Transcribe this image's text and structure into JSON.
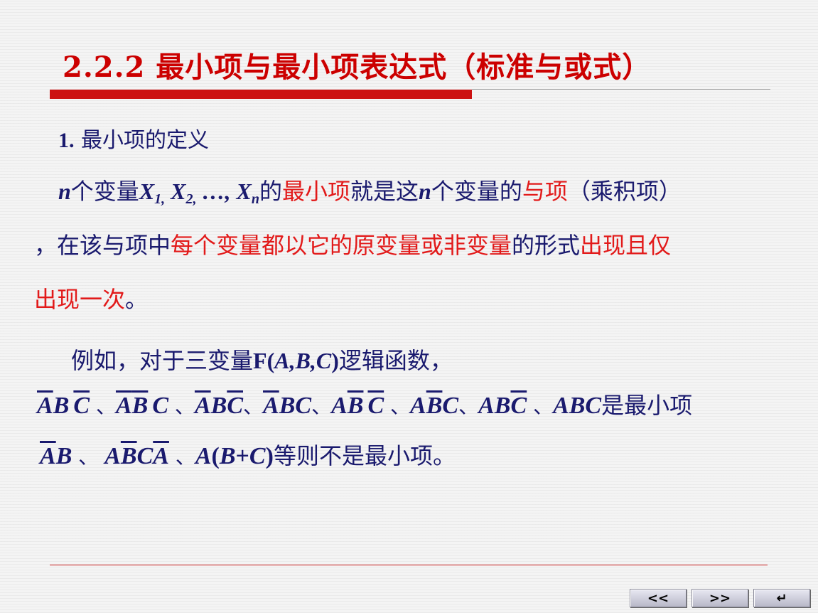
{
  "slide": {
    "title": "2.2.2  最小项与最小项表达式（标准与或式）",
    "heading_num": "1.",
    "heading_text": " 最小项的定义",
    "definition": {
      "n": "n",
      "t1": "个变量",
      "vars": {
        "x1": "X",
        "s1": "1,",
        "x2": " X",
        "s2": "2,",
        "dots": " …, X",
        "sn": "n"
      },
      "t2": "的",
      "t3": "最小项",
      "t4": "就是这",
      "n2": "n",
      "t5": "个变量的",
      "t6": "与项",
      "t7": "（乘积项）",
      "l2_a": "，在该与项中",
      "l2_b": "每个变量都以它的原变量或非变量",
      "l2_c": "的形式",
      "l2_d": "出现且仅",
      "l3_a": "出现一次",
      "l3_b": "。"
    },
    "example": {
      "prefix": "例如，对于三变量",
      "func": "F(",
      "args": "A,B,C",
      "close": ")",
      "suffix": "逻辑函数，"
    },
    "terms_suffix": "是最小项",
    "non_terms_suffix": "等则不是最小项。"
  },
  "nav": {
    "prev": "<<",
    "next": ">>",
    "return": "↵"
  }
}
